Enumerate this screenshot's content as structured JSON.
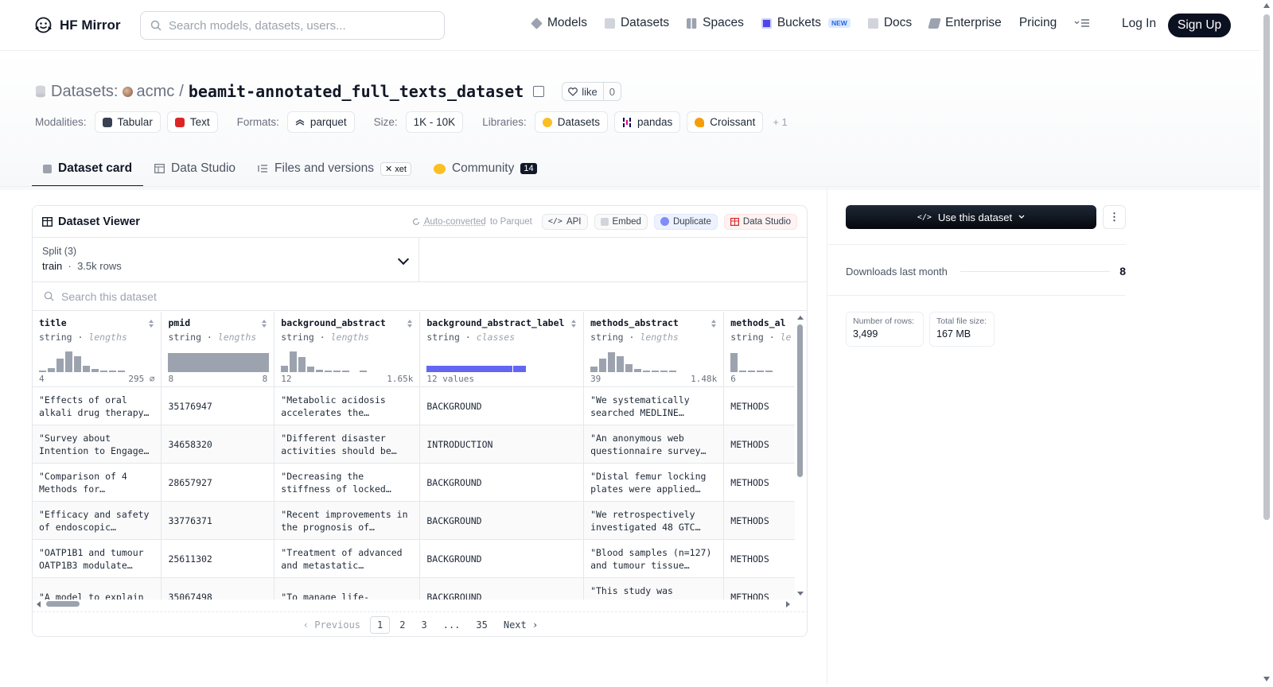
{
  "nav": {
    "brand": "HF Mirror",
    "search_placeholder": "Search models, datasets, users...",
    "links": [
      {
        "label": "Models",
        "icon": "models-icon"
      },
      {
        "label": "Datasets",
        "icon": "datasets-icon"
      },
      {
        "label": "Spaces",
        "icon": "spaces-icon"
      },
      {
        "label": "Buckets",
        "icon": "buckets-icon",
        "badge": "NEW"
      },
      {
        "label": "Docs",
        "icon": "docs-icon"
      },
      {
        "label": "Enterprise",
        "icon": "enterprise-icon"
      },
      {
        "label": "Pricing"
      }
    ],
    "login": "Log In",
    "signup": "Sign Up"
  },
  "header": {
    "section_label": "Datasets:",
    "owner": "acmc",
    "separator": "/",
    "repo_name": "beamit-annotated_full_texts_dataset",
    "like_label": "like",
    "like_count": "0",
    "modalities_label": "Modalities:",
    "modalities": [
      "Tabular",
      "Text"
    ],
    "formats_label": "Formats:",
    "formats": [
      "parquet"
    ],
    "size_label": "Size:",
    "size": "1K - 10K",
    "libraries_label": "Libraries:",
    "libraries": [
      "Datasets",
      "pandas",
      "Croissant"
    ],
    "libraries_more": "+ 1"
  },
  "tabs": [
    {
      "label": "Dataset card",
      "active": true
    },
    {
      "label": "Data Studio"
    },
    {
      "label": "Files and versions",
      "badge": "xet"
    },
    {
      "label": "Community",
      "count": "14"
    }
  ],
  "viewer": {
    "title": "Dataset Viewer",
    "auto_converted": "Auto-converted",
    "to_parquet": "to Parquet",
    "api": "API",
    "embed": "Embed",
    "duplicate": "Duplicate",
    "data_studio": "Data Studio",
    "split_label": "Split (3)",
    "split_value": "train",
    "split_rows": "3.5k rows",
    "search_placeholder": "Search this dataset",
    "columns": [
      {
        "name": "title",
        "type": "string",
        "stat": "lengths",
        "min": "4",
        "max": "295 ⌀"
      },
      {
        "name": "pmid",
        "type": "string",
        "stat": "lengths",
        "min": "8",
        "max": "8"
      },
      {
        "name": "background_abstract",
        "type": "string",
        "stat": "lengths",
        "min": "12",
        "max": "1.65k"
      },
      {
        "name": "background_abstract_label",
        "type": "string",
        "stat": "classes",
        "min": "12 values",
        "max": ""
      },
      {
        "name": "methods_abstract",
        "type": "string",
        "stat": "lengths",
        "min": "39",
        "max": "1.48k"
      },
      {
        "name": "methods_al",
        "type": "string",
        "stat": "le",
        "min": "6",
        "max": ""
      }
    ],
    "rows": [
      [
        "\"Effects of oral alkali drug therapy…",
        "35176947",
        "\"Metabolic acidosis accelerates the…",
        "BACKGROUND",
        "\"We systematically searched MEDLINE using…",
        "METHODS"
      ],
      [
        "\"Survey about Intention to Engage…",
        "34658320",
        "\"Different disaster activities should be…",
        "INTRODUCTION",
        "\"An anonymous web questionnaire survey…",
        "METHODS"
      ],
      [
        "\"Comparison of 4 Methods for…",
        "28657927",
        "\"Decreasing the stiffness of locked…",
        "BACKGROUND",
        "\"Distal femur locking plates were applied to…",
        "METHODS"
      ],
      [
        "\"Efficacy and safety of endoscopic…",
        "33776371",
        "\"Recent improvements in the prognosis of…",
        "BACKGROUND",
        "\"We retrospectively investigated 48 GTC…",
        "METHODS"
      ],
      [
        "\"OATP1B1 and tumour OATP1B3 modulate…",
        "25611302",
        "\"Treatment of advanced and metastatic…",
        "BACKGROUND",
        "\"Blood samples (n=127) and tumour tissue…",
        "METHODS"
      ],
      [
        "\"A model to explain",
        "35067498",
        "\"To manage life-",
        "BACKGROUND",
        "\"This study was applied",
        "METHODS"
      ]
    ],
    "pager": {
      "prev": "Previous",
      "pages": [
        "1",
        "2",
        "3",
        "...",
        "35"
      ],
      "current": "1",
      "next": "Next"
    }
  },
  "sidebar": {
    "use_button": "Use this dataset",
    "downloads_label": "Downloads last month",
    "downloads_value": "8",
    "rows_label": "Number of rows:",
    "rows_value": "3,499",
    "size_label": "Total file size:",
    "size_value": "167 MB"
  },
  "colors": {
    "accent_bar": "#6366f1",
    "primary_dark": "#0b1120",
    "hist_bar": "#9ca3af"
  }
}
